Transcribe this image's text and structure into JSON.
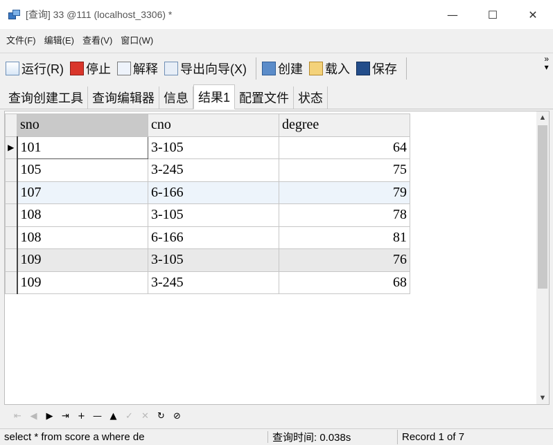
{
  "window": {
    "title": "[查询] 33 @111 (localhost_3306) *",
    "minimize": "—",
    "maximize": "☐",
    "close": "✕"
  },
  "menu": [
    "文件(F)",
    "编辑(E)",
    "查看(V)",
    "窗口(W)"
  ],
  "toolbar": {
    "run": "运行(R)",
    "stop": "停止",
    "explain": "解释",
    "export": "导出向导(X)",
    "create": "创建",
    "load": "载入",
    "save": "保存",
    "more": "»"
  },
  "tabs": [
    "查询创建工具",
    "查询编辑器",
    "信息",
    "结果1",
    "配置文件",
    "状态"
  ],
  "active_tab": "结果1",
  "grid": {
    "columns": [
      "sno",
      "cno",
      "degree"
    ],
    "rows": [
      {
        "sno": "101",
        "cno": "3-105",
        "degree": "64"
      },
      {
        "sno": "105",
        "cno": "3-245",
        "degree": "75"
      },
      {
        "sno": "107",
        "cno": "6-166",
        "degree": "79"
      },
      {
        "sno": "108",
        "cno": "3-105",
        "degree": "78"
      },
      {
        "sno": "108",
        "cno": "6-166",
        "degree": "81"
      },
      {
        "sno": "109",
        "cno": "3-105",
        "degree": "76"
      },
      {
        "sno": "109",
        "cno": "3-245",
        "degree": "68"
      }
    ],
    "current_row_marker": "▶"
  },
  "navbar": [
    "⇤",
    "◀",
    "▶",
    "⇥",
    "+",
    "—",
    "▲",
    "✓",
    "✕",
    "↻",
    "⊘"
  ],
  "status": {
    "sql": "select * from score a where  de",
    "time": "查询时间: 0.038s",
    "record": "Record 1 of 7"
  }
}
